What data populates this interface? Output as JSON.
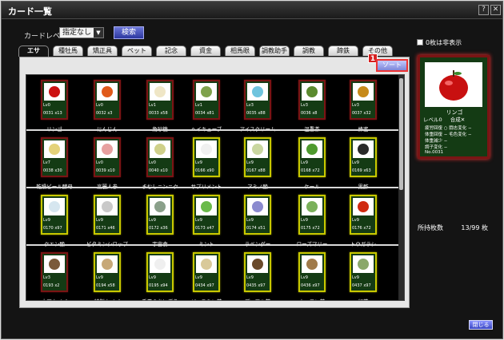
{
  "window": {
    "title": "カード一覧"
  },
  "titlebar": {
    "help_label": "?",
    "close_label": "✕"
  },
  "filter": {
    "label": "カードレベル:",
    "selected": "指定なし",
    "search_label": "検索"
  },
  "tabs": [
    {
      "label": "エサ",
      "active": true
    },
    {
      "label": "種牡馬"
    },
    {
      "label": "矯正具"
    },
    {
      "label": "ペット"
    },
    {
      "label": "記念"
    },
    {
      "label": "資金"
    },
    {
      "label": "相馬眼"
    },
    {
      "label": "調教助手"
    },
    {
      "label": "調教"
    },
    {
      "label": "蹄鉄"
    },
    {
      "label": "その他"
    }
  ],
  "sort": {
    "label": "ソート",
    "badge": "1"
  },
  "cards": [
    {
      "name": "リンゴ",
      "lv": "Lv0",
      "no": "0031",
      "count": "x13",
      "border": "red",
      "color": "#cc1010"
    },
    {
      "name": "にんじん",
      "lv": "Lv0",
      "no": "0032",
      "count": "x3",
      "border": "red",
      "color": "#e05a1a"
    },
    {
      "name": "角砂糖",
      "lv": "Lv1",
      "no": "0033",
      "count": "x58",
      "border": "red",
      "color": "#efe6c6"
    },
    {
      "name": "ヘイキューブ",
      "lv": "Lv1",
      "no": "0034",
      "count": "x81",
      "border": "red",
      "color": "#7fa24c"
    },
    {
      "name": "アイスクリーム",
      "lv": "Lv3",
      "no": "0035",
      "count": "x88",
      "border": "red",
      "color": "#6fc4de"
    },
    {
      "name": "温重茶",
      "lv": "Lv3",
      "no": "0036",
      "count": "x8",
      "border": "red",
      "color": "#5a8a2e"
    },
    {
      "name": "蜂蜜",
      "lv": "Lv3",
      "no": "0037",
      "count": "x32",
      "border": "red",
      "color": "#c78a1a"
    },
    {
      "name": "乾燥ビール酵母",
      "lv": "Lv7",
      "no": "0038",
      "count": "x30",
      "border": "red",
      "color": "#e4d27a"
    },
    {
      "name": "高麗人参",
      "lv": "Lv0",
      "no": "0039",
      "count": "x10",
      "border": "red",
      "color": "#e7a0a0"
    },
    {
      "name": "まむしニンニク",
      "lv": "Lv0",
      "no": "0040",
      "count": "x10",
      "border": "red",
      "color": "#cfd08a"
    },
    {
      "name": "サプリメント",
      "lv": "Lv9",
      "no": "0166",
      "count": "x90",
      "border": "gold",
      "color": "#f0f0f0"
    },
    {
      "name": "アミノ酸",
      "lv": "Lv9",
      "no": "0167",
      "count": "x88",
      "border": "gold",
      "color": "#c9d7a0"
    },
    {
      "name": "ケール",
      "lv": "Lv9",
      "no": "0168",
      "count": "x72",
      "border": "gold",
      "color": "#4e9a2e"
    },
    {
      "name": "黒酢",
      "lv": "Lv9",
      "no": "0169",
      "count": "x63",
      "border": "gold",
      "color": "#2a2a2a"
    },
    {
      "name": "クエン酸",
      "lv": "Lv9",
      "no": "0170",
      "count": "x97",
      "border": "gold",
      "color": "#d6e6ef"
    },
    {
      "name": "ビタミンシロップ",
      "lv": "Lv9",
      "no": "0171",
      "count": "x46",
      "border": "gold",
      "color": "#c9c9c9"
    },
    {
      "name": "宇宙食",
      "lv": "Lv9",
      "no": "0172",
      "count": "x36",
      "border": "gold",
      "color": "#8aa08a"
    },
    {
      "name": "ミント",
      "lv": "Lv9",
      "no": "0173",
      "count": "x47",
      "border": "gold",
      "color": "#6aba4a"
    },
    {
      "name": "ラベンダー",
      "lv": "Lv9",
      "no": "0174",
      "count": "x51",
      "border": "gold",
      "color": "#8b8bcf"
    },
    {
      "name": "ローズマリー",
      "lv": "Lv9",
      "no": "0175",
      "count": "x72",
      "border": "gold",
      "color": "#7ab05a"
    },
    {
      "name": "トウガラシ",
      "lv": "Lv9",
      "no": "0176",
      "count": "x72",
      "border": "gold",
      "color": "#d02a10"
    },
    {
      "name": "大豆カイバ",
      "lv": "Lv3",
      "no": "0193",
      "count": "x2",
      "border": "red",
      "color": "#7a5a3a"
    },
    {
      "name": "特製カイバ",
      "lv": "Lv9",
      "no": "0194",
      "count": "x58",
      "border": "gold",
      "color": "#c7a878"
    },
    {
      "name": "千夏のおにぎり",
      "lv": "Lv9",
      "no": "0195",
      "count": "x94",
      "border": "gold",
      "color": "#efefef"
    },
    {
      "name": "ジャスミン茶",
      "lv": "Lv9",
      "no": "0434",
      "count": "x97",
      "border": "gold",
      "color": "#d9c99a"
    },
    {
      "name": "プーアル茶",
      "lv": "Lv9",
      "no": "0435",
      "count": "x97",
      "border": "gold",
      "color": "#6a4a2a"
    },
    {
      "name": "ウーロン茶",
      "lv": "Lv9",
      "no": "0436",
      "count": "x97",
      "border": "gold",
      "color": "#a07a4a"
    },
    {
      "name": "緑茶",
      "lv": "Lv9",
      "no": "0437",
      "count": "x97",
      "border": "gold",
      "color": "#8aa86a"
    }
  ],
  "sidebar": {
    "hide_zero_label": "0枚は非表示",
    "preview": {
      "name": "リンゴ",
      "level": "レベル0",
      "status": "合成✕",
      "lines": [
        "疲労回復 ○ 闘志変化 −",
        "体重回復 − 毛色変化 −",
        "体重減少 −",
        "調子変化 −",
        "No.0031"
      ]
    },
    "owned_label": "所持枚数",
    "owned_value": "13/99 枚"
  },
  "footer": {
    "close_label": "閉じる"
  }
}
